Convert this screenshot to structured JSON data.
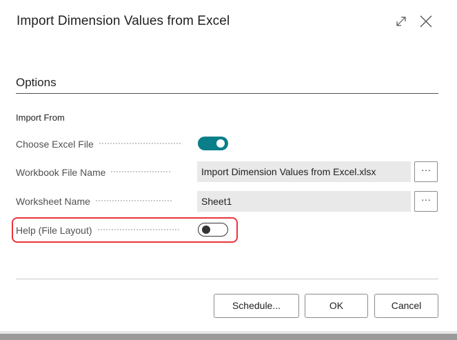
{
  "dialog": {
    "title": "Import Dimension Values from Excel"
  },
  "options": {
    "section_title": "Options",
    "group_label": "Import From",
    "fields": [
      {
        "label": "Choose Excel File",
        "type": "toggle",
        "value": "on"
      },
      {
        "label": "Workbook File Name",
        "type": "text",
        "value": "Import Dimension Values from Excel.xlsx",
        "button": "···"
      },
      {
        "label": "Worksheet Name",
        "type": "text",
        "value": "Sheet1",
        "button": "···"
      },
      {
        "label": "Help (File Layout)",
        "type": "toggle",
        "value": "off"
      }
    ]
  },
  "footer": {
    "schedule_label": "Schedule...",
    "ok_label": "OK",
    "cancel_label": "Cancel"
  },
  "colors": {
    "accent": "#0a7f8a",
    "highlight": "#e8343b"
  },
  "icons": [
    "expand-icon",
    "close-icon"
  ]
}
